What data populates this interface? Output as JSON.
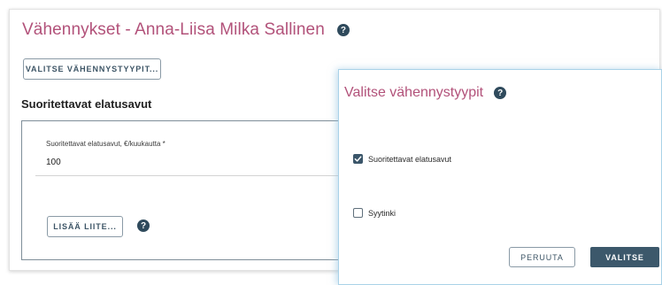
{
  "page": {
    "title": "Vähennykset - Anna-Liisa Milka Sallinen",
    "help_icon": "?",
    "select_types_label": "VALITSE VÄHENNYSTYYPIT...",
    "section": {
      "title": "Suoritettavat elatusavut",
      "field_label": "Suoritettavat elatusavut, €/kuukautta *",
      "field_value": "100",
      "add_attachment_label": "LISÄÄ LIITE...",
      "help_icon": "?"
    }
  },
  "dialog": {
    "title": "Valitse vähennystyypit",
    "help_icon": "?",
    "options": [
      {
        "label": "Suoritettavat elatusavut",
        "checked": true
      },
      {
        "label": "Syytinki",
        "checked": false
      }
    ],
    "cancel_label": "PERUUTA",
    "confirm_label": "VALITSE"
  },
  "colors": {
    "title": "#b2527a",
    "primary": "#3c586b",
    "dialog_border": "#a9d2e8"
  },
  "icons": {
    "help": "question-circle-icon",
    "check": "checkmark-icon"
  }
}
